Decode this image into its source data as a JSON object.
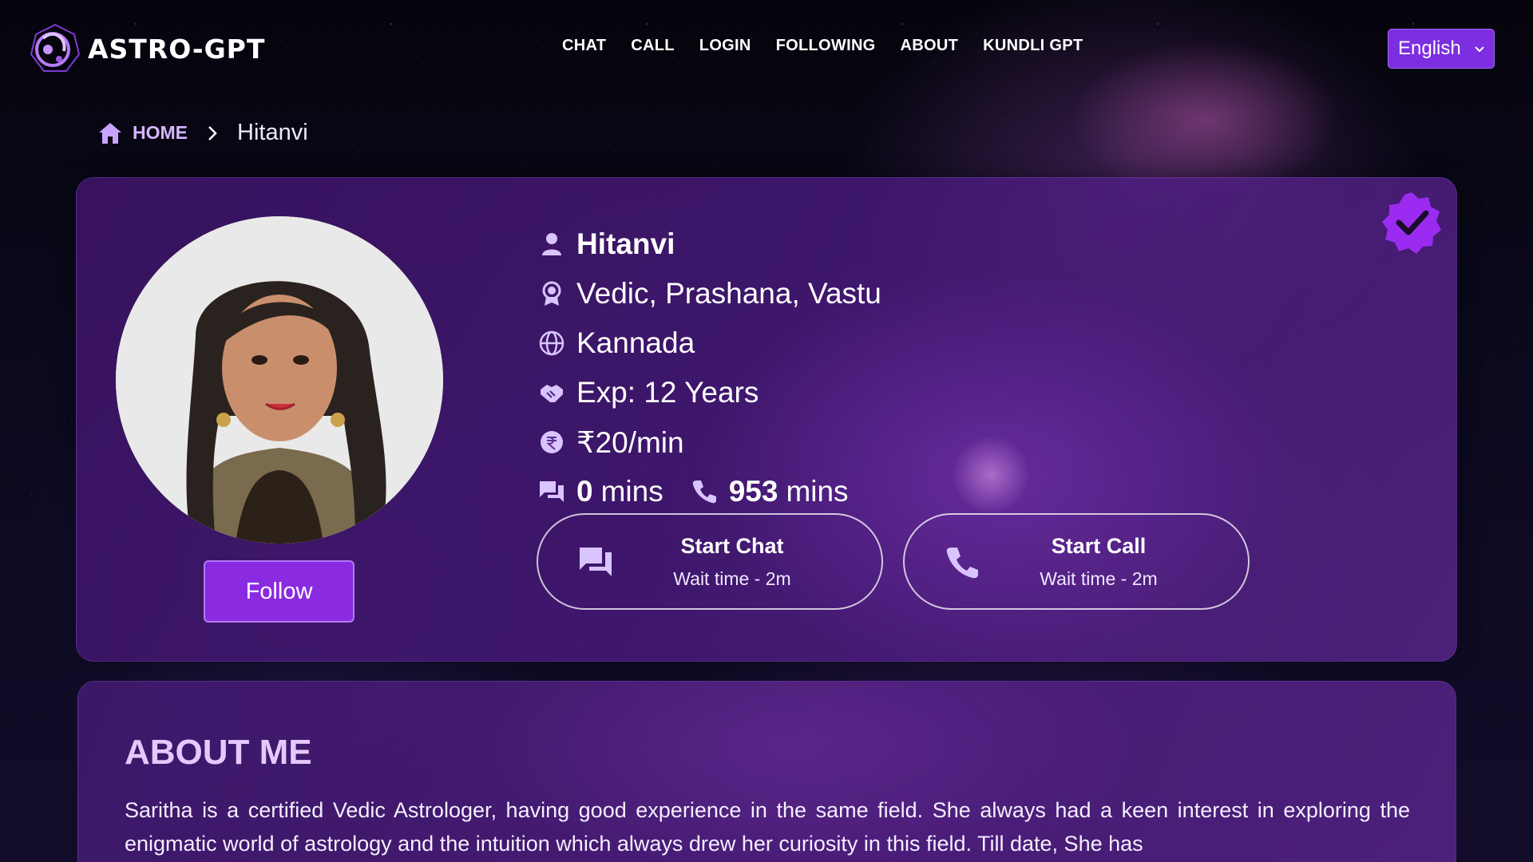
{
  "brand": {
    "name": "ASTRO-GPT",
    "accent": "#8a2be2"
  },
  "nav": {
    "items": [
      {
        "label": "CHAT"
      },
      {
        "label": "CALL"
      },
      {
        "label": "LOGIN"
      },
      {
        "label": "FOLLOWING"
      },
      {
        "label": "ABOUT"
      },
      {
        "label": "KUNDLI GPT"
      }
    ]
  },
  "language": {
    "selected": "English"
  },
  "breadcrumb": {
    "home": "HOME",
    "current": "Hitanvi"
  },
  "profile": {
    "name": "Hitanvi",
    "skills": "Vedic, Prashana, Vastu",
    "language": "Kannada",
    "experience": "Exp: 12 Years",
    "rate": "₹20/min",
    "chat_mins_value": "0",
    "chat_mins_unit": "mins",
    "call_mins_value": "953",
    "call_mins_unit": "mins",
    "follow_label": "Follow",
    "verified": true
  },
  "actions": {
    "chat": {
      "label": "Start Chat",
      "wait": "Wait time - 2m"
    },
    "call": {
      "label": "Start Call",
      "wait": "Wait time - 2m"
    }
  },
  "about": {
    "title": "ABOUT ME",
    "text": "Saritha is a certified Vedic Astrologer, having good experience in the same field. She always had a keen interest in exploring the enigmatic world of astrology and the intuition which always drew her curiosity in this field. Till date, She has"
  },
  "icons": {
    "logo": "astro-logo-icon",
    "home": "home-icon",
    "chevron": "chevron-right-icon",
    "user": "user-icon",
    "award": "award-icon",
    "globe": "globe-icon",
    "handshake": "handshake-icon",
    "rupee": "rupee-icon",
    "chat": "chat-icon",
    "phone": "phone-icon",
    "verified": "verified-badge-icon",
    "dropdown": "chevron-down-icon"
  }
}
